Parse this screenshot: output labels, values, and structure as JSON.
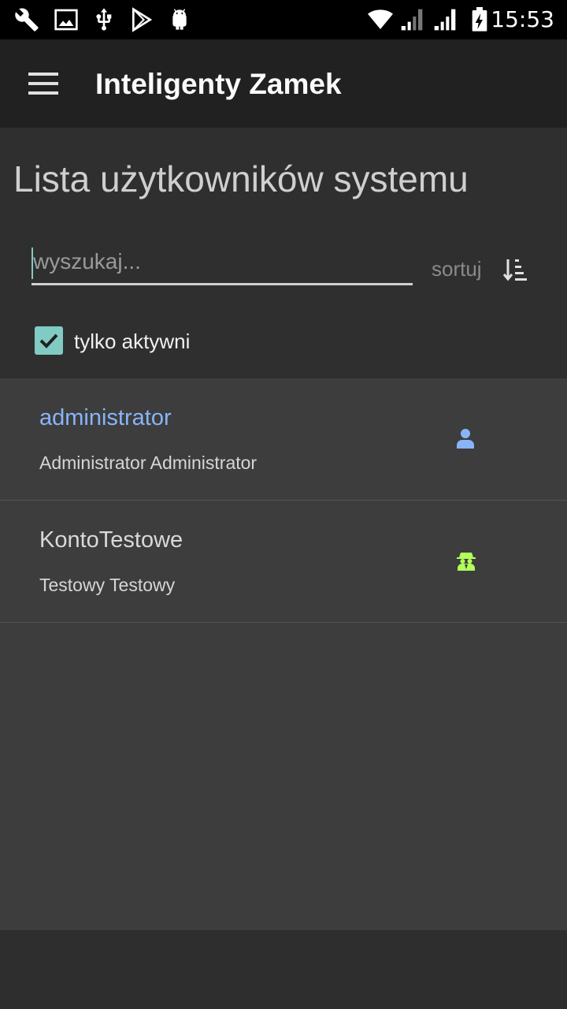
{
  "status_bar": {
    "time": "15:53",
    "left_icons": [
      "wrench-icon",
      "image-icon",
      "usb-icon",
      "play-store-icon",
      "android-icon"
    ],
    "right_icons": [
      "wifi-icon",
      "signal-icon",
      "signal-icon",
      "battery-charging-icon"
    ]
  },
  "app_bar": {
    "menu_icon": "hamburger-icon",
    "title": "Inteligenty Zamek"
  },
  "page": {
    "title": "Lista użytkowników systemu"
  },
  "search": {
    "placeholder": "wyszukaj...",
    "value": ""
  },
  "sort": {
    "label": "sortuj",
    "icon": "sort-descending-icon"
  },
  "filter": {
    "label": "tylko aktywni",
    "checked": true
  },
  "users": [
    {
      "login": "administrator",
      "full_name": "Administrator Administrator",
      "icon": "user-icon",
      "login_color": "#8ab4f8",
      "icon_color": "#8ab4f8"
    },
    {
      "login": "KontoTestowe",
      "full_name": "Testowy Testowy",
      "icon": "spy-icon",
      "login_color": "#d9d9d9",
      "icon_color": "#b2ff59"
    }
  ],
  "colors": {
    "accent": "#80cbc4",
    "app_bar": "#212121",
    "list_bg": "#3d3d3d"
  }
}
